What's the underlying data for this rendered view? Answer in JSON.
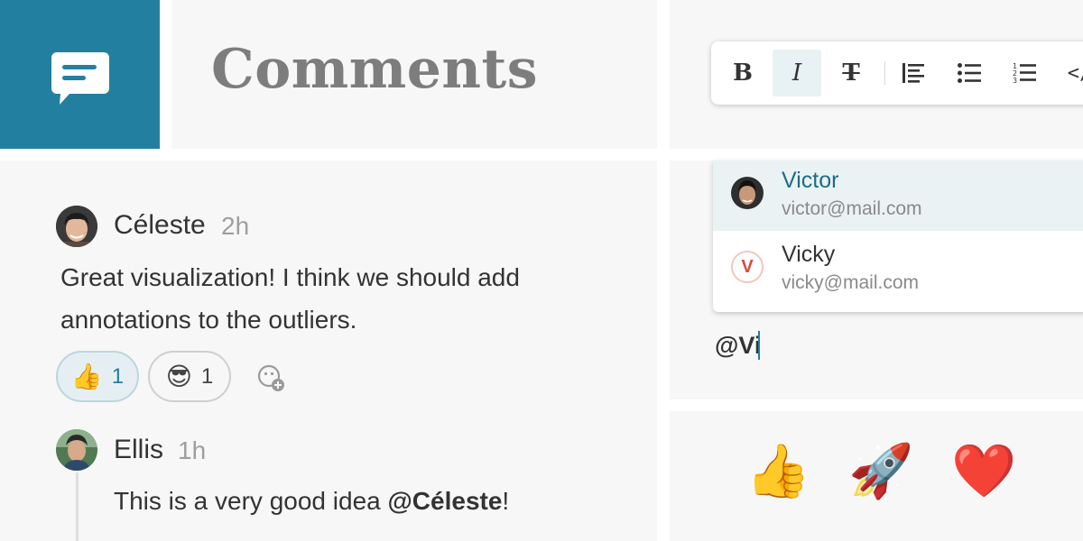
{
  "header": {
    "title": "Comments",
    "icon": "comment-bubble-icon",
    "accent_color": "#237f9f"
  },
  "toolbar": {
    "buttons": [
      {
        "name": "bold",
        "label": "B",
        "active": false
      },
      {
        "name": "italic",
        "label": "I",
        "active": true
      },
      {
        "name": "strikethrough",
        "label": "T",
        "active": false
      },
      {
        "name": "blockquote",
        "icon": "align-left-icon"
      },
      {
        "name": "bulleted-list",
        "icon": "bullet-list-icon"
      },
      {
        "name": "numbered-list",
        "icon": "numbered-list-icon"
      },
      {
        "name": "code",
        "label": "</"
      }
    ]
  },
  "thread": {
    "comment": {
      "author": "Céleste",
      "time": "2h",
      "text_line1": "Great visualization! I think we should add",
      "text_line2": "annotations to the outliers.",
      "reactions": [
        {
          "emoji": "👍",
          "count": "1",
          "selected": true
        },
        {
          "emoji": "😎",
          "count": "1",
          "selected": false
        }
      ]
    },
    "reply": {
      "author": "Ellis",
      "time": "1h",
      "text_prefix": "This is a very good idea ",
      "mention": "@Céleste",
      "text_suffix": "!"
    }
  },
  "mention": {
    "suggestions": [
      {
        "name": "Victor",
        "email": "victor@mail.com",
        "selected": true
      },
      {
        "name": "Vicky",
        "email": "vicky@mail.com",
        "initial": "V",
        "selected": false
      }
    ],
    "typed": "@Vi"
  },
  "emoji_bar": {
    "emojis": [
      "👍",
      "🚀",
      "❤️"
    ]
  }
}
